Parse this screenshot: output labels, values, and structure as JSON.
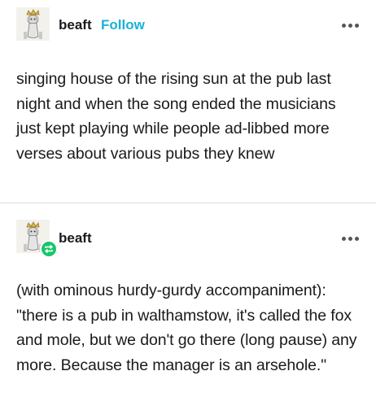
{
  "post1": {
    "username": "beaft",
    "follow_label": "Follow",
    "avatar_icon": "dog-with-crown-avatar-icon",
    "more_icon": "more-options-icon",
    "body": "singing house of the rising sun at the pub last night and when the song ended the musicians just kept playing while people ad-libbed more verses about various pubs they knew"
  },
  "post2": {
    "username": "beaft",
    "avatar_icon": "dog-with-crown-avatar-icon",
    "reblog_icon": "reblog-icon",
    "more_icon": "more-options-icon",
    "body": "(with ominous hurdy-gurdy accompaniment): \"there is a pub in walthamstow, it's called the fox and mole, but we don't go there (long pause) any more. Because the manager is an arsehole.\""
  },
  "colors": {
    "follow": "#1ab2d8",
    "reblog_badge": "#18c66b",
    "text": "#1a1a1a",
    "divider": "#dcdcdc"
  }
}
